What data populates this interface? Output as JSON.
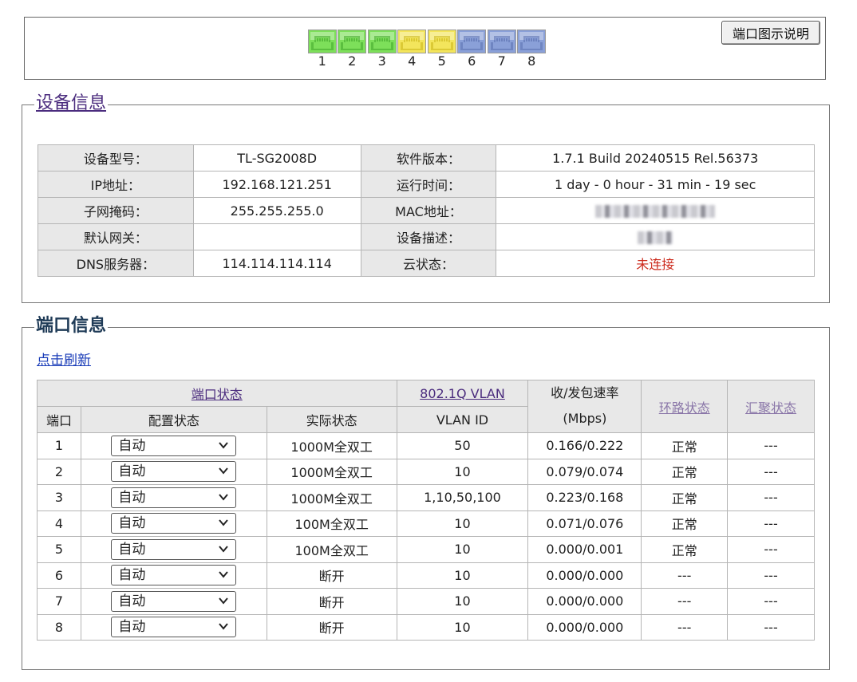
{
  "ports": {
    "items": [
      {
        "num": "1",
        "color": "#7ddf5a",
        "state": "1000M"
      },
      {
        "num": "2",
        "color": "#7ddf5a",
        "state": "1000M"
      },
      {
        "num": "3",
        "color": "#7ddf5a",
        "state": "1000M"
      },
      {
        "num": "4",
        "color": "#f3e55c",
        "state": "100M"
      },
      {
        "num": "5",
        "color": "#f3e55c",
        "state": "100M"
      },
      {
        "num": "6",
        "color": "#8aa0d8",
        "state": "down"
      },
      {
        "num": "7",
        "color": "#8aa0d8",
        "state": "down"
      },
      {
        "num": "8",
        "color": "#8aa0d8",
        "state": "down"
      }
    ],
    "legend_button": "端口图示说明"
  },
  "device": {
    "title": "设备信息",
    "rows": [
      {
        "l1": "设备型号：",
        "v1": "TL-SG2008D",
        "l2": "软件版本：",
        "v2": "1.7.1 Build 20240515 Rel.56373"
      },
      {
        "l1": "IP地址：",
        "v1": "192.168.121.251",
        "l2": "运行时间：",
        "v2": "1 day - 0 hour - 31 min - 19 sec"
      },
      {
        "l1": "子网掩码：",
        "v1": "255.255.255.0",
        "l2": "MAC地址：",
        "v2": ""
      },
      {
        "l1": "默认网关：",
        "v1": "",
        "l2": "设备描述：",
        "v2": ""
      },
      {
        "l1": "DNS服务器：",
        "v1": "114.114.114.114",
        "l2": "云状态：",
        "v2": "未连接"
      }
    ],
    "cloud_status_color": "#cc2a1c"
  },
  "portinfo": {
    "title": "端口信息",
    "refresh": "点击刷新",
    "headers": {
      "port_status": "端口状态",
      "vlan": "802.1Q VLAN",
      "rate": "收/发包速率",
      "rate_unit": "(Mbps)",
      "loop": "环路状态",
      "agg": "汇聚状态",
      "port": "端口",
      "config": "配置状态",
      "actual": "实际状态",
      "vlan_id": "VLAN ID"
    },
    "rows": [
      {
        "port": "1",
        "config": "自动",
        "actual": "1000M全双工",
        "vlan": "50",
        "rate": "0.166/0.222",
        "loop": "正常",
        "agg": "---"
      },
      {
        "port": "2",
        "config": "自动",
        "actual": "1000M全双工",
        "vlan": "10",
        "rate": "0.079/0.074",
        "loop": "正常",
        "agg": "---"
      },
      {
        "port": "3",
        "config": "自动",
        "actual": "1000M全双工",
        "vlan": "1,10,50,100",
        "rate": "0.223/0.168",
        "loop": "正常",
        "agg": "---"
      },
      {
        "port": "4",
        "config": "自动",
        "actual": "100M全双工",
        "vlan": "10",
        "rate": "0.071/0.076",
        "loop": "正常",
        "agg": "---"
      },
      {
        "port": "5",
        "config": "自动",
        "actual": "100M全双工",
        "vlan": "10",
        "rate": "0.000/0.001",
        "loop": "正常",
        "agg": "---"
      },
      {
        "port": "6",
        "config": "自动",
        "actual": "断开",
        "vlan": "10",
        "rate": "0.000/0.000",
        "loop": "---",
        "agg": "---"
      },
      {
        "port": "7",
        "config": "自动",
        "actual": "断开",
        "vlan": "10",
        "rate": "0.000/0.000",
        "loop": "---",
        "agg": "---"
      },
      {
        "port": "8",
        "config": "自动",
        "actual": "断开",
        "vlan": "10",
        "rate": "0.000/0.000",
        "loop": "---",
        "agg": "---"
      }
    ]
  }
}
